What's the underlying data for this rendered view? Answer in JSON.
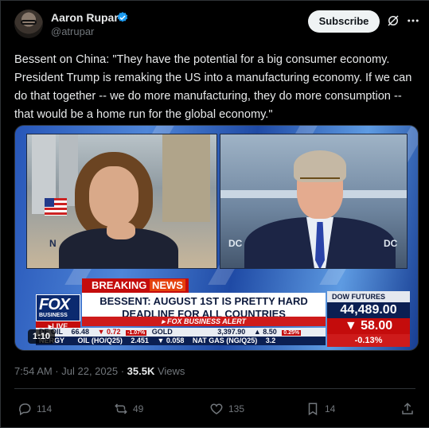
{
  "author": {
    "name": "Aaron Rupar",
    "handle": "@atrupar",
    "verified_color": "#1d9bf0"
  },
  "header": {
    "subscribe_label": "Subscribe",
    "icons": [
      "grok-icon",
      "more-icon"
    ]
  },
  "tweet": {
    "text": "Bessent on China: \"They have the potential for a big consumer economy. President Trump is remaking the US into a manufacturing economy. If we can do that together -- we do more manufacturing, they do more consumption -- that would be a home run for the global economy.\""
  },
  "video": {
    "duration": "1:10",
    "left_panel_label": "N",
    "right_panel_label_left": "DC",
    "right_panel_label_right": "DC",
    "breaking_prefix": "BREAKING",
    "breaking_suffix": "NEWS",
    "logo_text": "FOX",
    "logo_sub": "BUSINESS",
    "live_label": "LIVE",
    "headline_line1": "BESSENT: AUGUST 1ST IS PRETTY HARD",
    "headline_line2": "DEADLINE FOR ALL COUNTRIES",
    "strip_brand": "FOX BUSINESS",
    "strip_alert": "ALERT",
    "ticker_top": [
      {
        "label": "DE OIL",
        "value": "66.48",
        "change": "▼ 0.72",
        "badge": "-1.07%"
      },
      {
        "label": "GOLD",
        "value": "3,397.90",
        "change": "▲ 8.50",
        "badge": "0.25%"
      }
    ],
    "ticker_bottom": [
      {
        "label": "NERGY",
        "value": ""
      },
      {
        "label": "OIL (HO/Q25)",
        "value": "2.451",
        "change": "▼ 0.058"
      },
      {
        "label": "NAT GAS (NG/Q25)",
        "value": "3.2"
      }
    ],
    "dow": {
      "label": "DOW FUTURES",
      "value": "44,489.00",
      "change": "▼ 58.00",
      "percent": "-0.13%"
    }
  },
  "meta": {
    "time": "7:54 AM · Jul 22, 2025 · ",
    "views_count": "35.5K",
    "views_label": " Views"
  },
  "actions": {
    "replies": "114",
    "reposts": "49",
    "likes": "135",
    "bookmarks": "14"
  }
}
